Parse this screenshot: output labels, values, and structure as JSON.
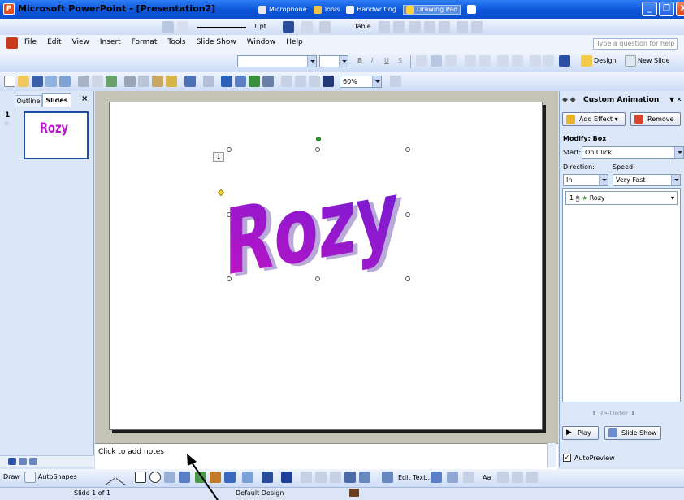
{
  "window": {
    "title": "Microsoft PowerPoint - [Presentation2]",
    "minimize": "_",
    "restore": "❐",
    "close": "X"
  },
  "language_bar": {
    "microphone": "Microphone",
    "tools": "Tools",
    "handwriting": "Handwriting",
    "drawing_pad": "Drawing Pad"
  },
  "drawing_top_toolbar": {
    "line_weight": "1 pt",
    "table": "Table"
  },
  "menu": {
    "items": [
      "File",
      "Edit",
      "View",
      "Insert",
      "Format",
      "Tools",
      "Slide Show",
      "Window",
      "Help"
    ],
    "help_placeholder": "Type a question for help"
  },
  "formatting": {
    "font_size": "",
    "bold": "B",
    "italic": "I",
    "underline": "U",
    "shadow": "S",
    "design": "Design",
    "new_slide": "New Slide"
  },
  "standard": {
    "zoom": "60%"
  },
  "left_pane": {
    "tab_outline": "Outline",
    "tab_slides": "Slides",
    "close": "×",
    "slide_number": "1",
    "thumbnail_text": "Rozy"
  },
  "slide": {
    "wordart_text": "Rozy",
    "animation_tag": "1",
    "wordart_gradient": [
      "#c414c4",
      "#6a1cd4"
    ],
    "wordart_shadow": "#b9a9d8"
  },
  "notes": {
    "placeholder": "Click to add notes"
  },
  "task_pane": {
    "title": "Custom Animation",
    "add_effect": "Add Effect",
    "remove": "Remove",
    "modify_label": "Modify: Box",
    "start_label": "Start:",
    "start_value": "On Click",
    "direction_label": "Direction:",
    "direction_value": "In",
    "speed_label": "Speed:",
    "speed_value": "Very Fast",
    "list_item_number": "1",
    "list_item_name": "Rozy",
    "reorder": "Re-Order",
    "play": "Play",
    "slide_show": "Slide Show",
    "autopreview": "AutoPreview",
    "autopreview_checked": "✓"
  },
  "drawing_toolbar": {
    "draw": "Draw",
    "autoshapes": "AutoShapes",
    "edit_text": "Edit Text...",
    "aa": "Aa"
  },
  "status_bar": {
    "slide_info": "Slide 1 of 1",
    "design": "Default Design"
  },
  "colors": {
    "titlebar": "#0a54d8",
    "wordart_magenta": "#c414c4",
    "wordart_violet": "#6a1cd4",
    "work_area": "#c3c3b6"
  }
}
